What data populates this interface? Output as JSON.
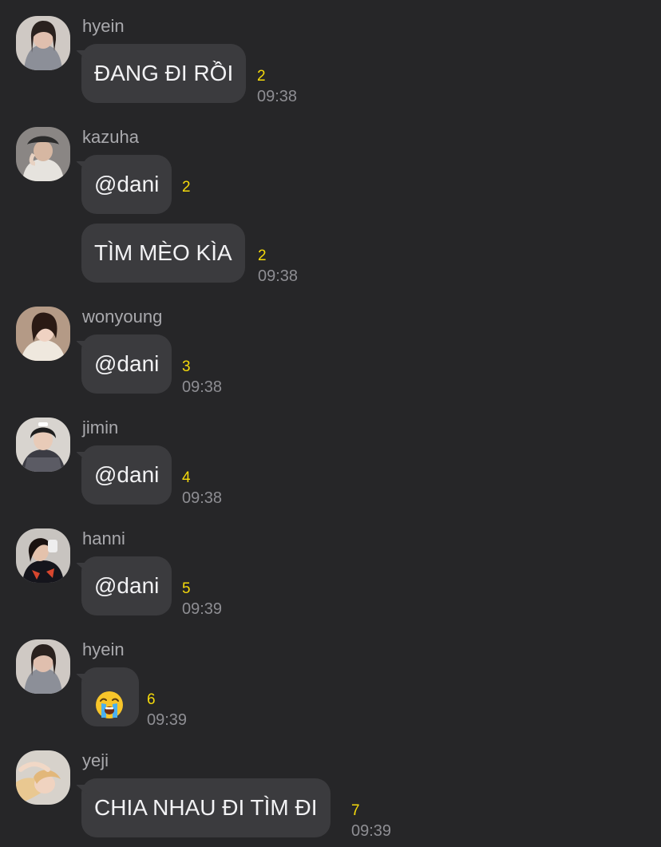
{
  "messages": [
    {
      "sender": "hyein",
      "bubbles": [
        {
          "text": "ĐANG ĐI RỒI",
          "count": "2",
          "time": "09:38"
        }
      ]
    },
    {
      "sender": "kazuha",
      "bubbles": [
        {
          "text": "@dani",
          "count": "2",
          "time": ""
        },
        {
          "text": "TÌM MÈO KÌA",
          "count": "2",
          "time": "09:38"
        }
      ]
    },
    {
      "sender": "wonyoung",
      "bubbles": [
        {
          "text": "@dani",
          "count": "3",
          "time": "09:38"
        }
      ]
    },
    {
      "sender": "jimin",
      "bubbles": [
        {
          "text": "@dani",
          "count": "4",
          "time": "09:38"
        }
      ]
    },
    {
      "sender": "hanni",
      "bubbles": [
        {
          "text": "@dani",
          "count": "5",
          "time": "09:39"
        }
      ]
    },
    {
      "sender": "hyein",
      "bubbles": [
        {
          "emoji": "crying-face",
          "count": "6",
          "time": "09:39"
        }
      ]
    },
    {
      "sender": "yeji",
      "bubbles": [
        {
          "text": "CHIA NHAU ĐI TÌM ĐI",
          "count": "7",
          "time": "09:39"
        }
      ]
    }
  ],
  "colors": {
    "background": "#262628",
    "bubble": "#3b3b3e",
    "text": "#f2f2f4",
    "sender": "#a9a9ad",
    "unread_count": "#f4d90b",
    "time": "#8e8e93"
  }
}
